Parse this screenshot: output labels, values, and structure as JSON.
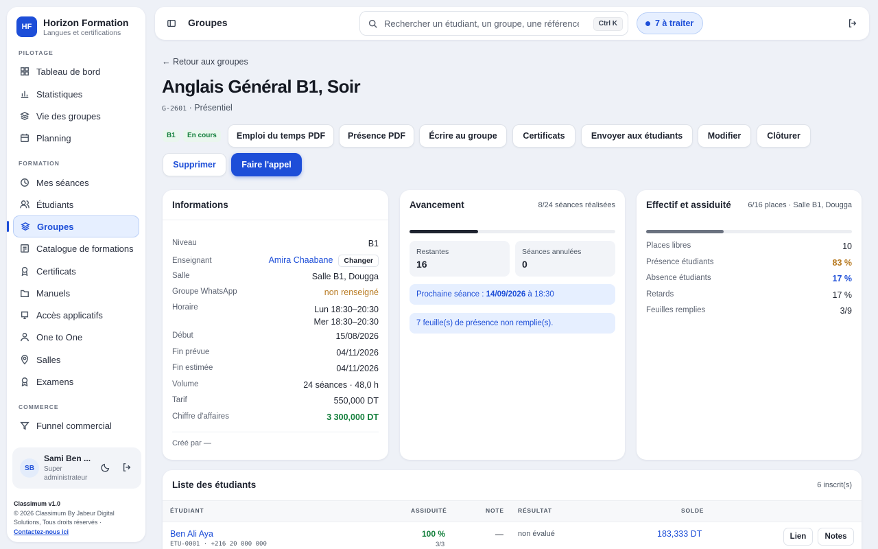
{
  "brand": {
    "logo": "HF",
    "name": "Horizon Formation",
    "subtitle": "Langues et certifications"
  },
  "sidebar": {
    "sections": [
      {
        "title": "PILOTAGE",
        "items": [
          {
            "label": "Tableau de bord",
            "icon": "grid-icon"
          },
          {
            "label": "Statistiques",
            "icon": "chart-icon"
          },
          {
            "label": "Vie des groupes",
            "icon": "layers-icon"
          },
          {
            "label": "Planning",
            "icon": "calendar-icon"
          }
        ]
      },
      {
        "title": "FORMATION",
        "items": [
          {
            "label": "Mes séances",
            "icon": "clock-icon"
          },
          {
            "label": "Étudiants",
            "icon": "users-icon"
          },
          {
            "label": "Groupes",
            "icon": "layers-icon",
            "active": true
          },
          {
            "label": "Catalogue de formations",
            "icon": "book-icon"
          },
          {
            "label": "Certificats",
            "icon": "award-icon"
          },
          {
            "label": "Manuels",
            "icon": "folder-icon"
          },
          {
            "label": "Accès applicatifs",
            "icon": "key-icon"
          },
          {
            "label": "One to One",
            "icon": "user-icon"
          },
          {
            "label": "Salles",
            "icon": "pin-icon"
          },
          {
            "label": "Examens",
            "icon": "award-icon"
          }
        ]
      },
      {
        "title": "COMMERCE",
        "items": [
          {
            "label": "Funnel commercial",
            "icon": "funnel-icon"
          }
        ]
      }
    ],
    "user": {
      "initials": "SB",
      "name": "Sami Ben ...",
      "role": "Super administrateur"
    },
    "footer": {
      "version": "Classimum v1.0",
      "copyright": "© 2026 Classimum By Jabeur Digital Solutions, Tous droits réservés ·",
      "contact": "Contactez-nous ici"
    }
  },
  "topbar": {
    "title": "Groupes",
    "search_placeholder": "Rechercher un étudiant, un groupe, une référence",
    "shortcut": "Ctrl K",
    "todo": "7 à traiter"
  },
  "header": {
    "back": "← Retour aux groupes",
    "title": "Anglais Général B1, Soir",
    "code": "G-2601",
    "mode": " · Présentiel",
    "level_tag": "B1",
    "status_tag": "En cours",
    "actions": [
      "Emploi du temps PDF",
      "Présence PDF",
      "Écrire au groupe",
      "Certificats",
      "Envoyer aux étudiants",
      "Modifier",
      "Clôturer"
    ],
    "delete": "Supprimer",
    "call": "Faire l'appel"
  },
  "info": {
    "title": "Informations",
    "niveau": {
      "k": "Niveau",
      "v": "B1"
    },
    "enseignant": {
      "k": "Enseignant",
      "v": "Amira Chaabane",
      "change": "Changer"
    },
    "salle": {
      "k": "Salle",
      "v": "Salle B1, Dougga"
    },
    "whatsapp": {
      "k": "Groupe WhatsApp",
      "v": "non renseigné"
    },
    "horaire": {
      "k": "Horaire",
      "v1": "Lun 18:30–20:30",
      "v2": "Mer 18:30–20:30"
    },
    "debut": {
      "k": "Début",
      "v": "15/08/2026"
    },
    "fin_prevue": {
      "k": "Fin prévue",
      "v": "04/11/2026"
    },
    "fin_estimee": {
      "k": "Fin estimée",
      "v": "04/11/2026"
    },
    "volume": {
      "k": "Volume",
      "v": "24 séances · 48,0 h"
    },
    "tarif": {
      "k": "Tarif",
      "v": "550,000 DT"
    },
    "ca": {
      "k": "Chiffre d'affaires",
      "v": "3 300,000 DT"
    },
    "created": "Créé par —"
  },
  "progress": {
    "title": "Avancement",
    "summary": "8/24 séances réalisées",
    "done": 8,
    "total": 24,
    "remaining_label": "Restantes",
    "remaining": "16",
    "cancelled_label": "Séances annulées",
    "cancelled": "0",
    "next_label": "Prochaine séance : ",
    "next_date": "14/09/2026",
    "next_time": " à 18:30",
    "pending": "7 feuille(s) de présence non remplie(s)."
  },
  "attendance": {
    "title": "Effectif et assiduité",
    "summary": "6/16 places · Salle B1, Dougga",
    "fill": 0.375,
    "rows": [
      {
        "k": "Places libres",
        "v": "10"
      },
      {
        "k": "Présence étudiants",
        "v": "83 %"
      },
      {
        "k": "Absence étudiants",
        "v": "17 %"
      },
      {
        "k": "Retards",
        "v": "17 %"
      },
      {
        "k": "Feuilles remplies",
        "v": "3/9"
      }
    ]
  },
  "students": {
    "title": "Liste des étudiants",
    "count": "6 inscrit(s)",
    "columns": [
      "ÉTUDIANT",
      "ASSIDUITÉ",
      "NOTE",
      "RÉSULTAT",
      "SOLDE"
    ],
    "rows": [
      {
        "name": "Ben Ali Aya",
        "meta": "ETU-0001 · +216 20 000 000",
        "attendance": "100 %",
        "attendance_sub": "3/3",
        "note": "—",
        "result": "non évalué",
        "balance": "183,333 DT",
        "link": "Lien",
        "notes": "Notes"
      }
    ]
  },
  "colors": {
    "accent": "#1d4ed8",
    "warning": "#b7791f",
    "success": "#15803d"
  }
}
